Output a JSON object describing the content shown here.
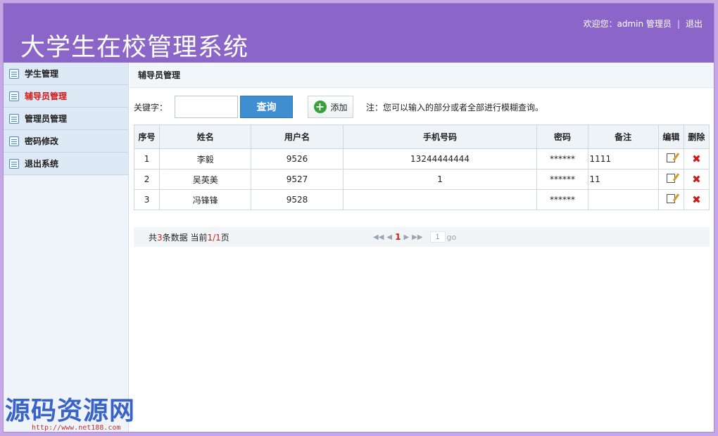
{
  "header": {
    "title": "大学生在校管理系统",
    "welcome": "欢迎您：admin 管理员",
    "separator": "|",
    "logout": "退出"
  },
  "sidebar": {
    "items": [
      {
        "label": "学生管理",
        "icon": "list-icon"
      },
      {
        "label": "辅导员管理",
        "icon": "list-icon",
        "active": true
      },
      {
        "label": "管理员管理",
        "icon": "list-icon"
      },
      {
        "label": "密码修改",
        "icon": "list-icon"
      },
      {
        "label": "退出系统",
        "icon": "list-icon"
      }
    ]
  },
  "main": {
    "section_title": "辅导员管理",
    "search": {
      "label": "关键字：",
      "value": "",
      "query_label": "查询",
      "add_label": "添加",
      "note": "注：您可以输入的部分或者全部进行模糊查询。"
    },
    "table": {
      "headers": [
        "序号",
        "姓名",
        "用户名",
        "手机号码",
        "密码",
        "备注",
        "编辑",
        "删除"
      ],
      "rows": [
        {
          "no": "1",
          "name": "李毅",
          "username": "9526",
          "phone": "13244444444",
          "password": "******",
          "remark": "1111"
        },
        {
          "no": "2",
          "name": "吴英美",
          "username": "9527",
          "phone": "1",
          "password": "******",
          "remark": "11"
        },
        {
          "no": "3",
          "name": "冯锋锋",
          "username": "9528",
          "phone": "",
          "password": "******",
          "remark": ""
        }
      ]
    },
    "pager": {
      "prefix": "共",
      "total": "3",
      "middle": "条数据 当前",
      "current": "1/1",
      "suffix": "页",
      "current_page": "1",
      "page_input": "1",
      "go": "go"
    }
  },
  "watermark": {
    "text": "源码资源网",
    "url": "http://www.net188.com"
  },
  "colors": {
    "header_bg": "#8b66c8",
    "active_menu": "#d21a1a",
    "query_button": "#3f8fd0",
    "delete_icon": "#c81e1e"
  }
}
